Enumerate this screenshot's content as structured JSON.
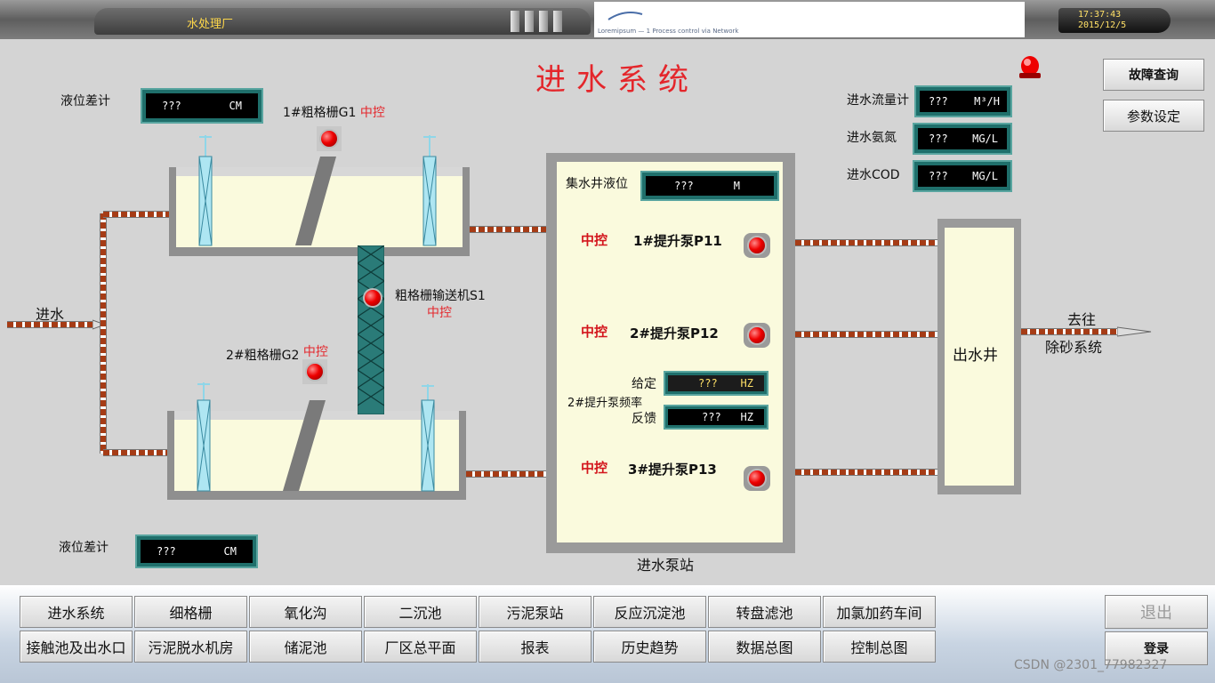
{
  "header": {
    "app_title": "水处理厂",
    "banner_text": "Loremipsum — 1 Process control via Network",
    "clock_time": "17:37:43",
    "clock_date": "2015/12/5"
  },
  "screen_title": "进水系统",
  "left": {
    "level_diff_label_top": "液位差计",
    "level_diff_top_value": "???",
    "level_diff_top_unit": "CM",
    "level_diff_label_bottom": "液位差计",
    "level_diff_bottom_value": "???",
    "level_diff_bottom_unit": "CM",
    "inlet_label": "进水"
  },
  "grates": {
    "g1_label": "1#粗格栅G1",
    "g1_mode": "中控",
    "g2_label": "2#粗格栅G2",
    "g2_mode": "中控",
    "conveyor_label": "粗格栅输送机S1",
    "conveyor_mode": "中控"
  },
  "pump_station": {
    "station_label": "进水泵站",
    "well_level_label": "集水井液位",
    "well_level_value": "???",
    "well_level_unit": "M",
    "p11_mode": "中控",
    "p11_label": "1#提升泵P11",
    "p12_mode": "中控",
    "p12_label": "2#提升泵P12",
    "p13_mode": "中控",
    "p13_label": "3#提升泵P13",
    "freq_label": "2#提升泵频率",
    "set_label": "给定",
    "set_value": "???",
    "set_unit": "HZ",
    "fb_label": "反馈",
    "fb_value": "???",
    "fb_unit": "HZ"
  },
  "outlet": {
    "well_label": "出水井",
    "goto_line1": "去往",
    "goto_line2": "除砂系统"
  },
  "meters": {
    "flow_label": "进水流量计",
    "flow_value": "???",
    "flow_unit": "M³/H",
    "nh3_label": "进水氨氮",
    "nh3_value": "???",
    "nh3_unit": "MG/L",
    "cod_label": "进水COD",
    "cod_value": "???",
    "cod_unit": "MG/L"
  },
  "side_buttons": {
    "fault_query": "故障查询",
    "param_settings": "参数设定"
  },
  "nav": {
    "row1": [
      "进水系统",
      "细格栅",
      "氧化沟",
      "二沉池",
      "污泥泵站",
      "反应沉淀池",
      "转盘滤池",
      "加氯加药车间"
    ],
    "row2": [
      "接触池及出水口",
      "污泥脱水机房",
      "储泥池",
      "厂区总平面",
      "报表",
      "历史趋势",
      "数据总图",
      "控制总图"
    ],
    "exit_label": "退出",
    "login_label": "登录",
    "watermark": "CSDN @2301_77982327"
  },
  "colors": {
    "accent_red": "#e4262b",
    "readout_frame": "#1f6f6b",
    "water": "#fafadd",
    "pipe": "#a63c16"
  }
}
